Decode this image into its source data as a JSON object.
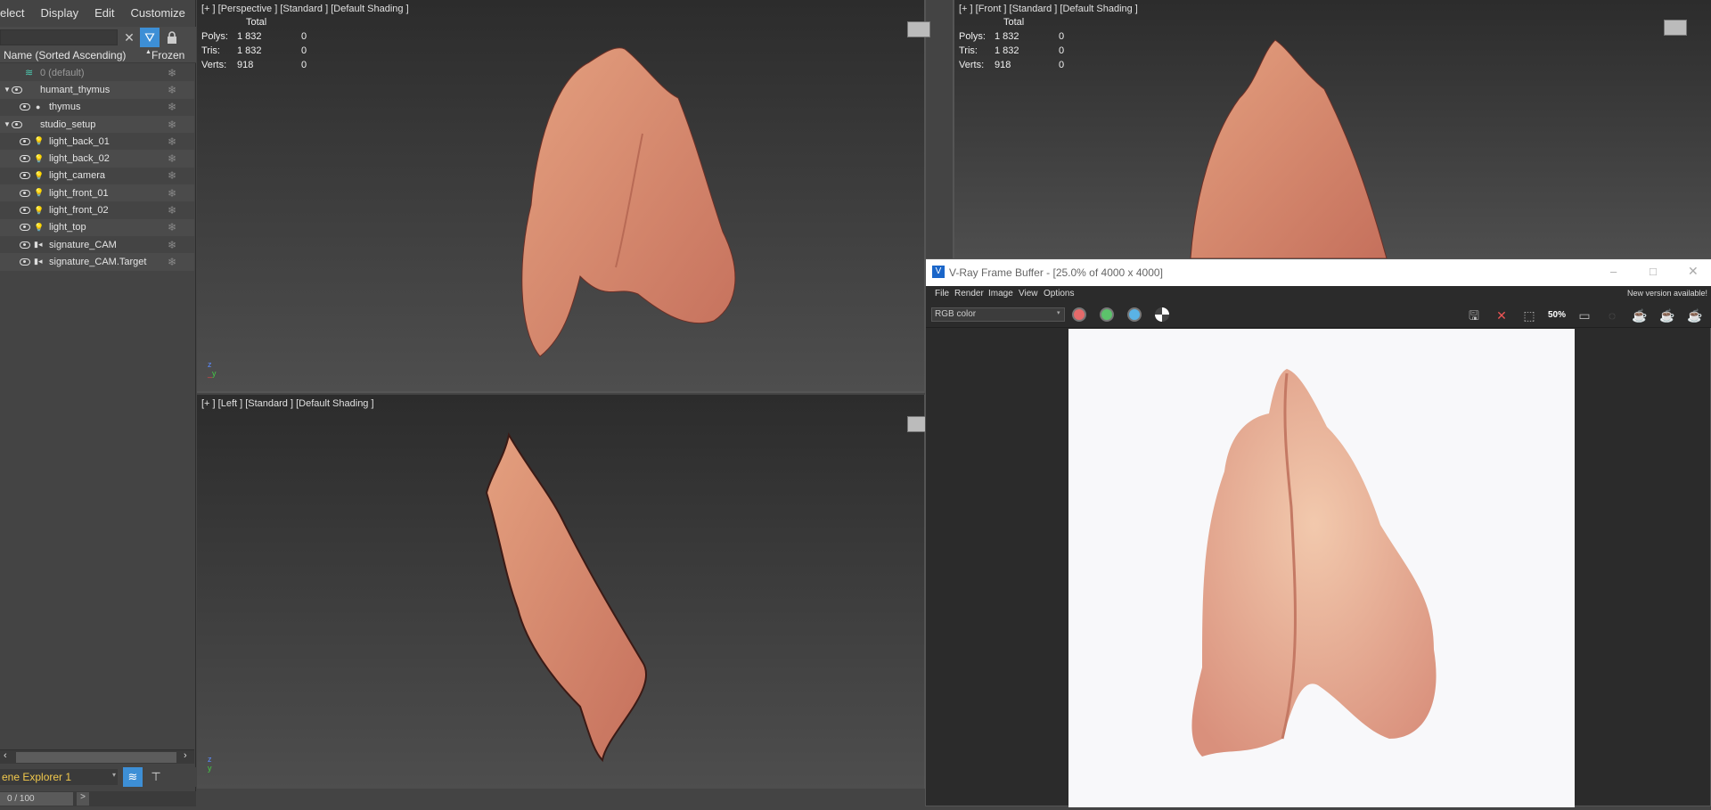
{
  "menu": {
    "items": [
      "elect",
      "Display",
      "Edit",
      "Customize"
    ]
  },
  "explorer": {
    "column_name": "Name (Sorted Ascending)",
    "column_frozen": "Frozen",
    "rows": [
      {
        "label": "0 (default)",
        "type": "layer",
        "dim": true
      },
      {
        "label": "humant_thymus",
        "type": "layer"
      },
      {
        "label": "thymus",
        "type": "mesh"
      },
      {
        "label": "studio_setup",
        "type": "layer"
      },
      {
        "label": "light_back_01",
        "type": "light"
      },
      {
        "label": "light_back_02",
        "type": "light"
      },
      {
        "label": "light_camera",
        "type": "light"
      },
      {
        "label": "light_front_01",
        "type": "light"
      },
      {
        "label": "light_front_02",
        "type": "light"
      },
      {
        "label": "light_top",
        "type": "light"
      },
      {
        "label": "signature_CAM",
        "type": "camera"
      },
      {
        "label": "signature_CAM.Target",
        "type": "camera"
      }
    ],
    "name": "ene Explorer 1",
    "time": "0 / 100",
    "next": ">"
  },
  "viewports": {
    "perspective": {
      "label": "[+ ] [Perspective ]  [Standard ]  [Default Shading ]"
    },
    "front": {
      "label": "[+ ] [Front ]  [Standard ]  [Default Shading ]"
    },
    "left": {
      "label": "[+ ]  [Left ]   [Standard ]  [Default Shading ]"
    },
    "stats": {
      "header": "Total",
      "polys_k": "Polys:",
      "polys": "1 832",
      "polys_sel": "0",
      "tris_k": "Tris:",
      "tris": "1 832",
      "tris_sel": "0",
      "verts_k": "Verts:",
      "verts": "918",
      "verts_sel": "0"
    }
  },
  "vfb": {
    "title": "V-Ray Frame Buffer - [25.0% of 4000 x 4000]",
    "menu": [
      "File",
      "Render",
      "Image",
      "View",
      "Options"
    ],
    "new_version": "New version available!",
    "channel": "RGB color",
    "zoom": "50%"
  },
  "colors": {
    "accent": "#3d8fd6",
    "highlight": "#f2c94c",
    "red": "#e46a6a",
    "green": "#5cc26b",
    "blue": "#5ab3e6"
  }
}
